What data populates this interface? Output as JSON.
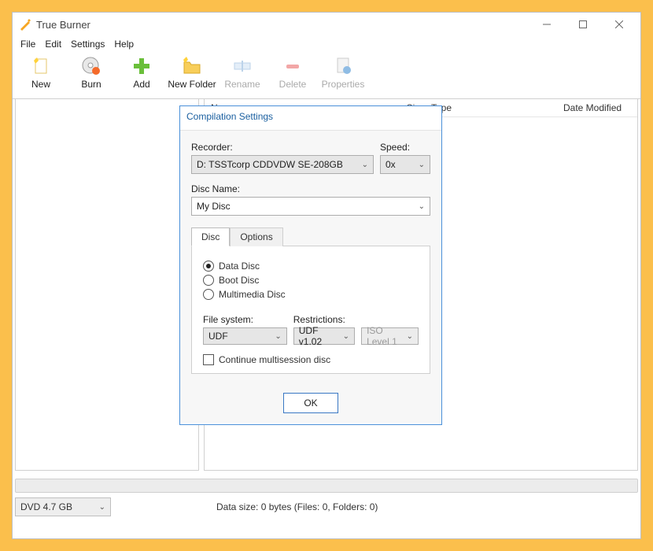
{
  "window": {
    "title": "True Burner"
  },
  "menubar": {
    "file": "File",
    "edit": "Edit",
    "settings": "Settings",
    "help": "Help"
  },
  "toolbar": {
    "new": "New",
    "burn": "Burn",
    "add": "Add",
    "newfolder": "New Folder",
    "rename": "Rename",
    "delete": "Delete",
    "properties": "Properties"
  },
  "columns": {
    "name": "Name",
    "size": "Size",
    "type": "Type",
    "date": "Date Modified"
  },
  "status": {
    "media": "DVD 4.7 GB",
    "text": "Data size: 0 bytes (Files: 0, Folders: 0)"
  },
  "dialog": {
    "title": "Compilation Settings",
    "recorder_label": "Recorder:",
    "recorder_value": "D: TSSTcorp CDDVDW SE-208GB",
    "speed_label": "Speed:",
    "speed_value": "0x",
    "discname_label": "Disc Name:",
    "discname_value": "My Disc",
    "tabs": {
      "disc": "Disc",
      "options": "Options"
    },
    "radios": {
      "data": "Data Disc",
      "boot": "Boot Disc",
      "multimedia": "Multimedia Disc"
    },
    "fs_label": "File system:",
    "fs_value": "UDF",
    "rest_label": "Restrictions:",
    "rest_value": "UDF v1.02",
    "iso_value": "ISO Level 1",
    "multisession": "Continue multisession disc",
    "ok": "OK"
  }
}
